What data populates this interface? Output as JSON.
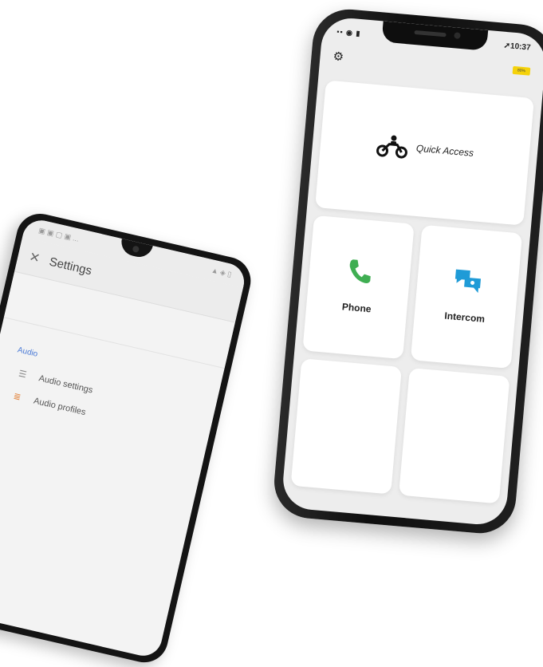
{
  "android": {
    "status_icons": "▣ ▣ ▢ ▣ ...",
    "status_right": "▲ ◈ ▯",
    "header": {
      "close_icon": "close-icon",
      "title": "Settings"
    },
    "section_title": "Audio",
    "rows": [
      {
        "icon": "sliders-icon",
        "label": "Audio settings"
      },
      {
        "icon": "equalizer-icon",
        "label": "Audio profiles"
      }
    ]
  },
  "iphone": {
    "status_left": "▪▪ ◉ ▮",
    "time": "10:37",
    "settings_icon": "gear-icon",
    "battery_label": "80%",
    "tiles": {
      "quick_access": {
        "label": "Quick Access",
        "icon": "motorcycle-icon"
      },
      "phone": {
        "label": "Phone",
        "icon": "phone-icon"
      },
      "intercom": {
        "label": "Intercom",
        "icon": "intercom-icon"
      }
    }
  },
  "colors": {
    "phone_green": "#3fae52",
    "intercom_blue": "#1f9bd7",
    "battery_yellow": "#f5d20a",
    "audio_blue": "#4a7ad6"
  }
}
